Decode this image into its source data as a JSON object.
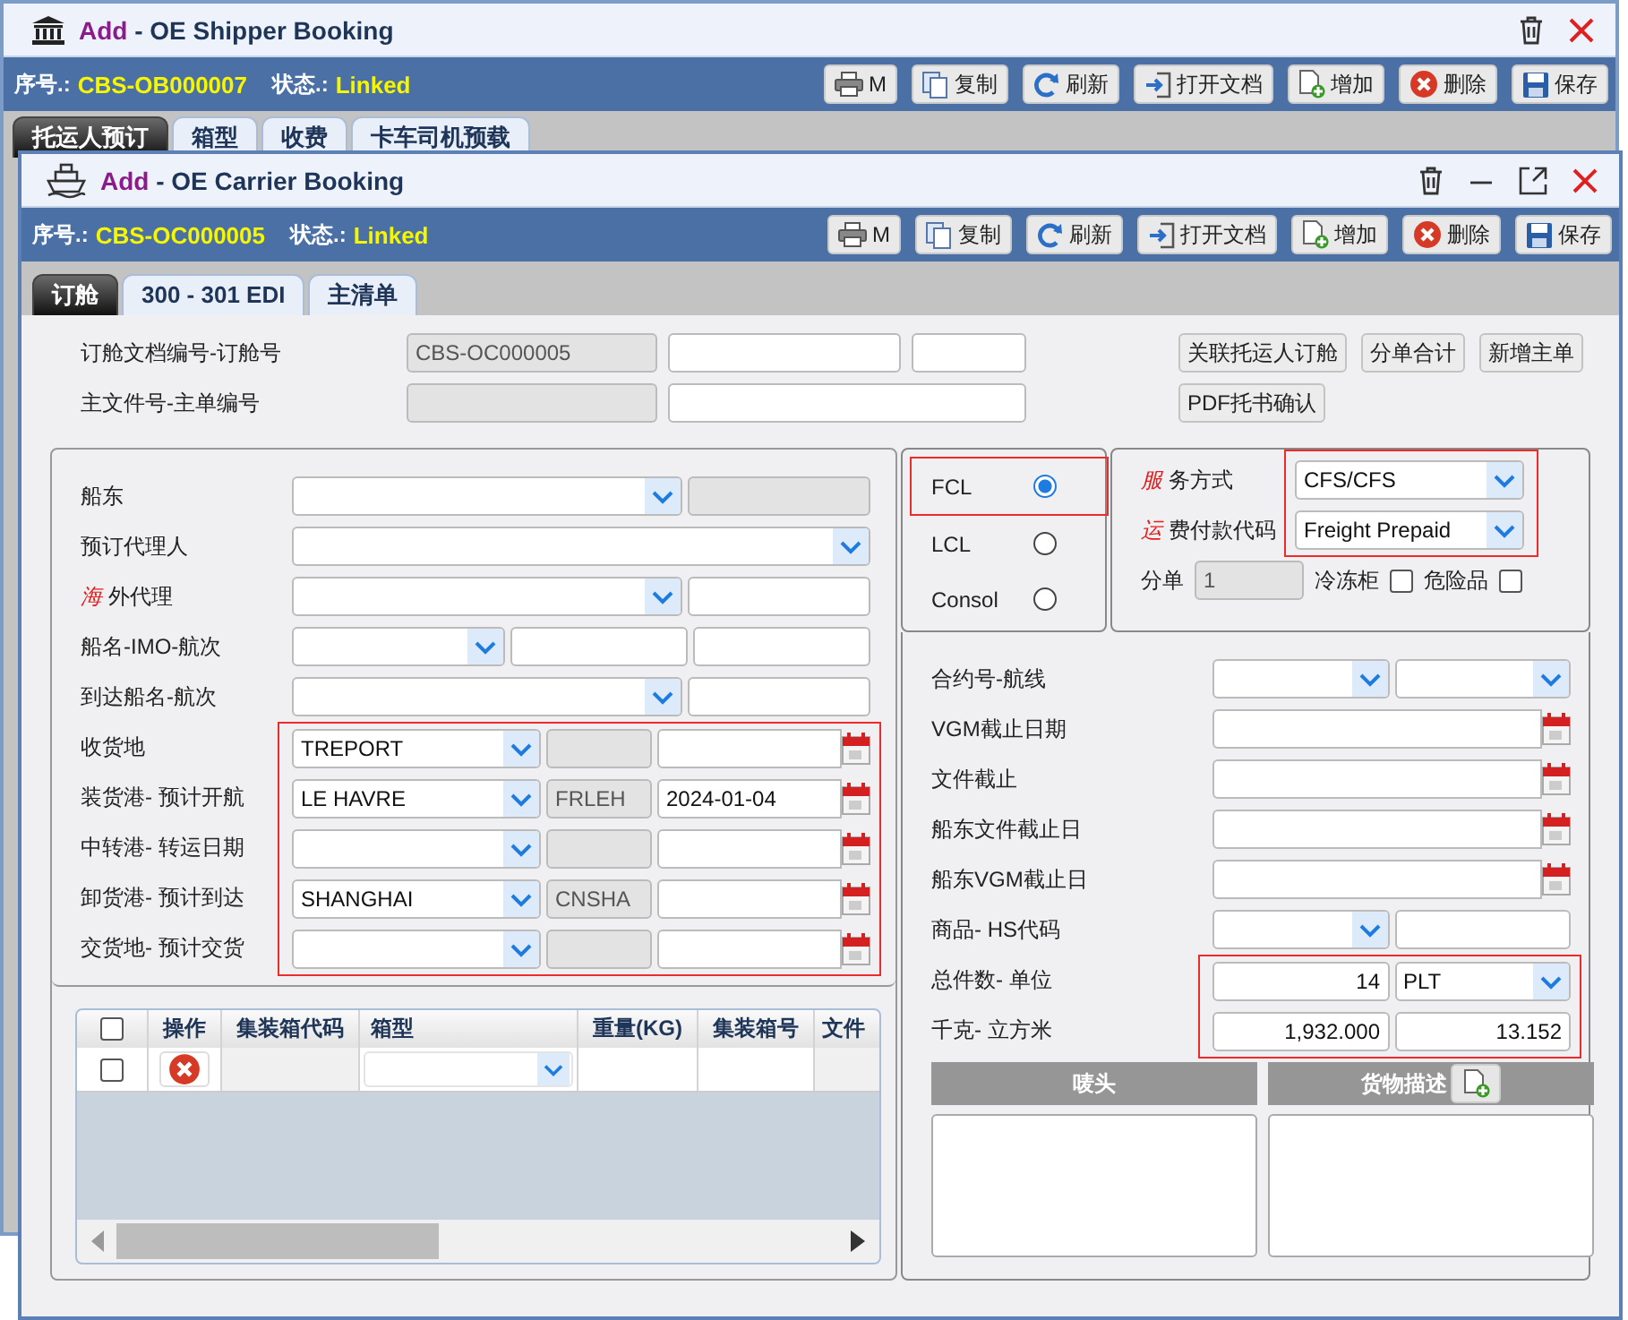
{
  "back_window": {
    "title_prefix": "Add",
    "title": "- OE Shipper Booking",
    "controls": [
      {
        "kind": "trash"
      },
      {
        "kind": "close"
      }
    ],
    "info": {
      "serial_label": "序号.:",
      "serial": "CBS-OB000007",
      "status_label": "状态.:",
      "status": "Linked"
    },
    "toolbar": [
      {
        "kind": "print",
        "label": "M"
      },
      {
        "kind": "copy",
        "label": "复制"
      },
      {
        "kind": "refresh",
        "label": "刷新"
      },
      {
        "kind": "open",
        "label": "打开文档"
      },
      {
        "kind": "add",
        "label": "增加"
      },
      {
        "kind": "delete",
        "label": "删除"
      },
      {
        "kind": "save",
        "label": "保存"
      }
    ],
    "tabs": [
      {
        "label": "托运人预订",
        "selected": true
      },
      {
        "label": "箱型",
        "selected": false
      },
      {
        "label": "收费",
        "selected": false
      },
      {
        "label": "卡车司机预载",
        "selected": false
      }
    ]
  },
  "front_window": {
    "title_prefix": "Add",
    "title": "- OE Carrier Booking",
    "controls": [
      {
        "kind": "trash"
      },
      {
        "kind": "minimize"
      },
      {
        "kind": "maximize"
      },
      {
        "kind": "close"
      }
    ],
    "info": {
      "serial_label": "序号.:",
      "serial": "CBS-OC000005",
      "status_label": "状态.:",
      "status": "Linked"
    },
    "toolbar": [
      {
        "kind": "print",
        "label": "M"
      },
      {
        "kind": "copy",
        "label": "复制"
      },
      {
        "kind": "refresh",
        "label": "刷新"
      },
      {
        "kind": "open",
        "label": "打开文档"
      },
      {
        "kind": "add",
        "label": "增加"
      },
      {
        "kind": "delete",
        "label": "删除"
      },
      {
        "kind": "save",
        "label": "保存"
      }
    ],
    "tabs": [
      {
        "label": "订舱",
        "selected": true
      },
      {
        "label": "300 - 301 EDI",
        "selected": false
      },
      {
        "label": "主清单",
        "selected": false
      }
    ],
    "doc_rows": [
      {
        "label": "订舱文档编号-订舱号",
        "fields": [
          {
            "kind": "readonly",
            "value": "CBS-OC000005"
          },
          {
            "kind": "text"
          },
          {
            "kind": "text"
          }
        ]
      },
      {
        "label": "主文件号-主单编号",
        "fields": [
          {
            "kind": "readonly"
          },
          {
            "kind": "text"
          }
        ]
      }
    ],
    "actions": [
      [
        "关联托运人订舱",
        "分单合计",
        "新增主单"
      ],
      [
        "PDF托书确认"
      ]
    ],
    "left_rows": [
      {
        "label": "船东",
        "highlighted": false,
        "fields": [
          {
            "kind": "select"
          },
          {
            "kind": "readonly"
          }
        ]
      },
      {
        "label": "预订代理人",
        "highlighted": false,
        "fields": [
          {
            "kind": "select"
          }
        ]
      },
      {
        "accent": "海",
        "label": "外代理",
        "highlighted": false,
        "fields": [
          {
            "kind": "select"
          },
          {
            "kind": "text"
          }
        ]
      },
      {
        "label": "船名-IMO-航次",
        "highlighted": false,
        "fields": [
          {
            "kind": "select"
          },
          {
            "kind": "text"
          },
          {
            "kind": "text"
          }
        ]
      },
      {
        "label": "到达船名-航次",
        "highlighted": false,
        "fields": [
          {
            "kind": "select"
          },
          {
            "kind": "text"
          }
        ]
      },
      {
        "label": "收货地",
        "highlighted": true,
        "fields": [
          {
            "kind": "select",
            "value": "TREPORT"
          },
          {
            "kind": "readonly"
          },
          {
            "kind": "date"
          }
        ]
      },
      {
        "label": "装货港- 预计开航",
        "highlighted": true,
        "fields": [
          {
            "kind": "select",
            "value": "LE HAVRE"
          },
          {
            "kind": "readonly",
            "value": "FRLEH"
          },
          {
            "kind": "date",
            "value": "2024-01-04"
          }
        ]
      },
      {
        "label": "中转港- 转运日期",
        "highlighted": true,
        "fields": [
          {
            "kind": "select"
          },
          {
            "kind": "readonly"
          },
          {
            "kind": "date"
          }
        ]
      },
      {
        "label": "卸货港- 预计到达",
        "highlighted": true,
        "fields": [
          {
            "kind": "select",
            "value": "SHANGHAI"
          },
          {
            "kind": "readonly",
            "value": "CNSHA"
          },
          {
            "kind": "date"
          }
        ]
      },
      {
        "label": "交货地- 预计交货",
        "highlighted": true,
        "fields": [
          {
            "kind": "select"
          },
          {
            "kind": "readonly"
          },
          {
            "kind": "date"
          }
        ]
      }
    ],
    "container_table": {
      "header_checked": false,
      "columns": [
        "操作",
        "集装箱代码",
        "箱型",
        "重量(KG)",
        "集装箱号",
        "文件"
      ],
      "rows": [
        {
          "checked": false,
          "cells": [
            {
              "kind": "delete"
            },
            {
              "kind": "readonly"
            },
            {
              "kind": "select"
            },
            {
              "kind": "text"
            },
            {
              "kind": "text"
            },
            {
              "kind": "readonly"
            }
          ]
        }
      ]
    },
    "load_types": [
      {
        "label": "FCL",
        "selected": true,
        "highlighted": true
      },
      {
        "label": "LCL",
        "selected": false,
        "highlighted": false
      },
      {
        "label": "Consol",
        "selected": false,
        "highlighted": false
      }
    ],
    "service": {
      "highlighted": true,
      "rows": [
        {
          "accent": "服",
          "label": "务方式",
          "value": "CFS/CFS"
        },
        {
          "accent": "运",
          "label": "费付款代码",
          "value": "Freight Prepaid"
        }
      ],
      "split_label": "分单",
      "split_value": "1",
      "options": [
        {
          "label": "冷冻柜",
          "checked": false
        },
        {
          "label": "危险品",
          "checked": false
        }
      ]
    },
    "right_rows": [
      {
        "label": "合约号-航线",
        "highlighted": false,
        "fields": [
          {
            "kind": "select"
          },
          {
            "kind": "select"
          }
        ]
      },
      {
        "label": "VGM截止日期",
        "highlighted": false,
        "fields": [
          {
            "kind": "date"
          }
        ]
      },
      {
        "label": "文件截止",
        "highlighted": false,
        "fields": [
          {
            "kind": "date"
          }
        ]
      },
      {
        "label": "船东文件截止日",
        "highlighted": false,
        "fields": [
          {
            "kind": "date"
          }
        ]
      },
      {
        "label": "船东VGM截止日",
        "highlighted": false,
        "fields": [
          {
            "kind": "date"
          }
        ]
      },
      {
        "label": "商品- HS代码",
        "highlighted": false,
        "fields": [
          {
            "kind": "select"
          },
          {
            "kind": "text"
          }
        ]
      },
      {
        "label": "总件数- 单位",
        "highlighted": true,
        "fields": [
          {
            "kind": "number",
            "value": "14"
          },
          {
            "kind": "select",
            "value": "PLT"
          }
        ]
      },
      {
        "label": "千克- 立方米",
        "highlighted": true,
        "fields": [
          {
            "kind": "number",
            "value": "1,932.000"
          },
          {
            "kind": "number",
            "value": "13.152"
          }
        ]
      }
    ],
    "memos": [
      {
        "label": "唛头",
        "add_button": false
      },
      {
        "label": "货物描述",
        "add_button": true
      }
    ]
  }
}
